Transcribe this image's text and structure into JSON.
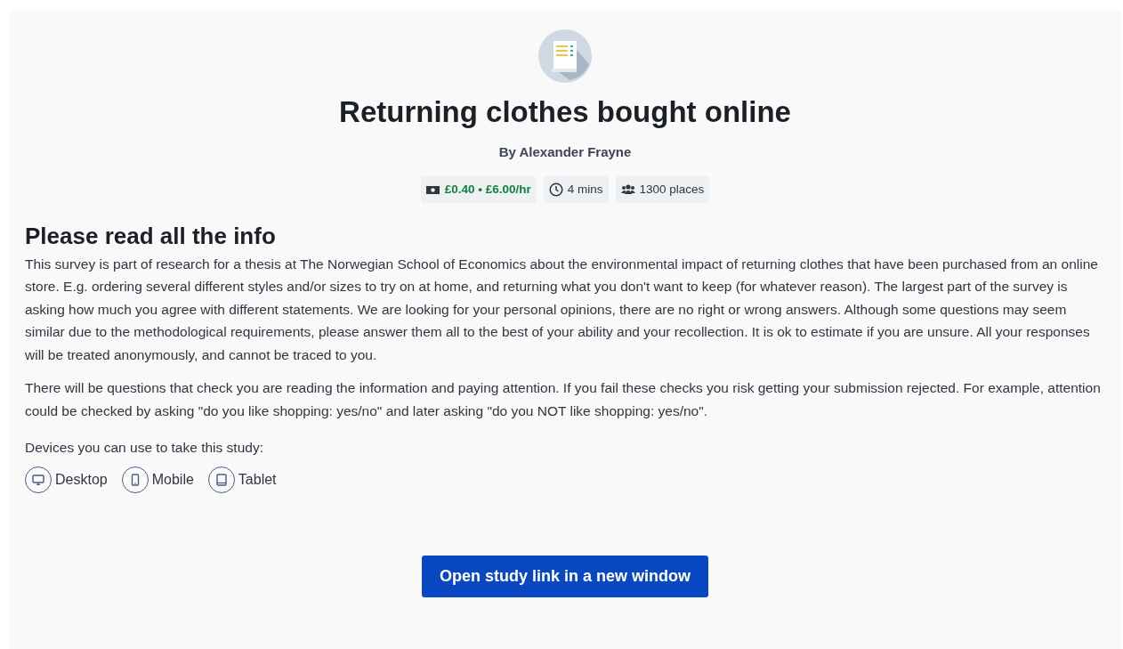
{
  "study": {
    "title": "Returning clothes bought online",
    "author": "By Alexander Frayne"
  },
  "tags": [
    {
      "kind": "reward",
      "label": "£0.40 • £6.00/hr"
    },
    {
      "kind": "time",
      "label": "4 mins"
    },
    {
      "kind": "places",
      "label": "1300 places"
    }
  ],
  "info": {
    "heading": "Please read all the info",
    "paragraphs": [
      "This survey is part of research for a thesis at The Norwegian School of Economics about the environmental impact of returning clothes that have been purchased from an online store. E.g. ordering several different styles and/or sizes to try on at home, and returning what you don't want to keep (for whatever reason). The largest part of the survey is asking how much you agree with different statements. We are looking for your personal opinions, there are no right or wrong answers. Although some questions may seem similar due to the methodological requirements, please answer them all to the best of your ability and your recollection. It is ok to estimate if you are unsure. All your responses will be treated anonymously, and cannot be traced to you.",
      "There will be questions that check you are reading the information and paying attention. If you fail these checks you risk getting your submission rejected. For example, attention could be checked by asking \"do you like shopping: yes/no\" and later asking \"do you NOT like shopping: yes/no\"."
    ],
    "devices_label": "Devices you can use to take this study:",
    "devices": [
      {
        "kind": "desktop",
        "label": "Desktop"
      },
      {
        "kind": "mobile",
        "label": "Mobile"
      },
      {
        "kind": "tablet",
        "label": "Tablet"
      }
    ]
  },
  "action": {
    "label": "Open study link in a new window"
  }
}
